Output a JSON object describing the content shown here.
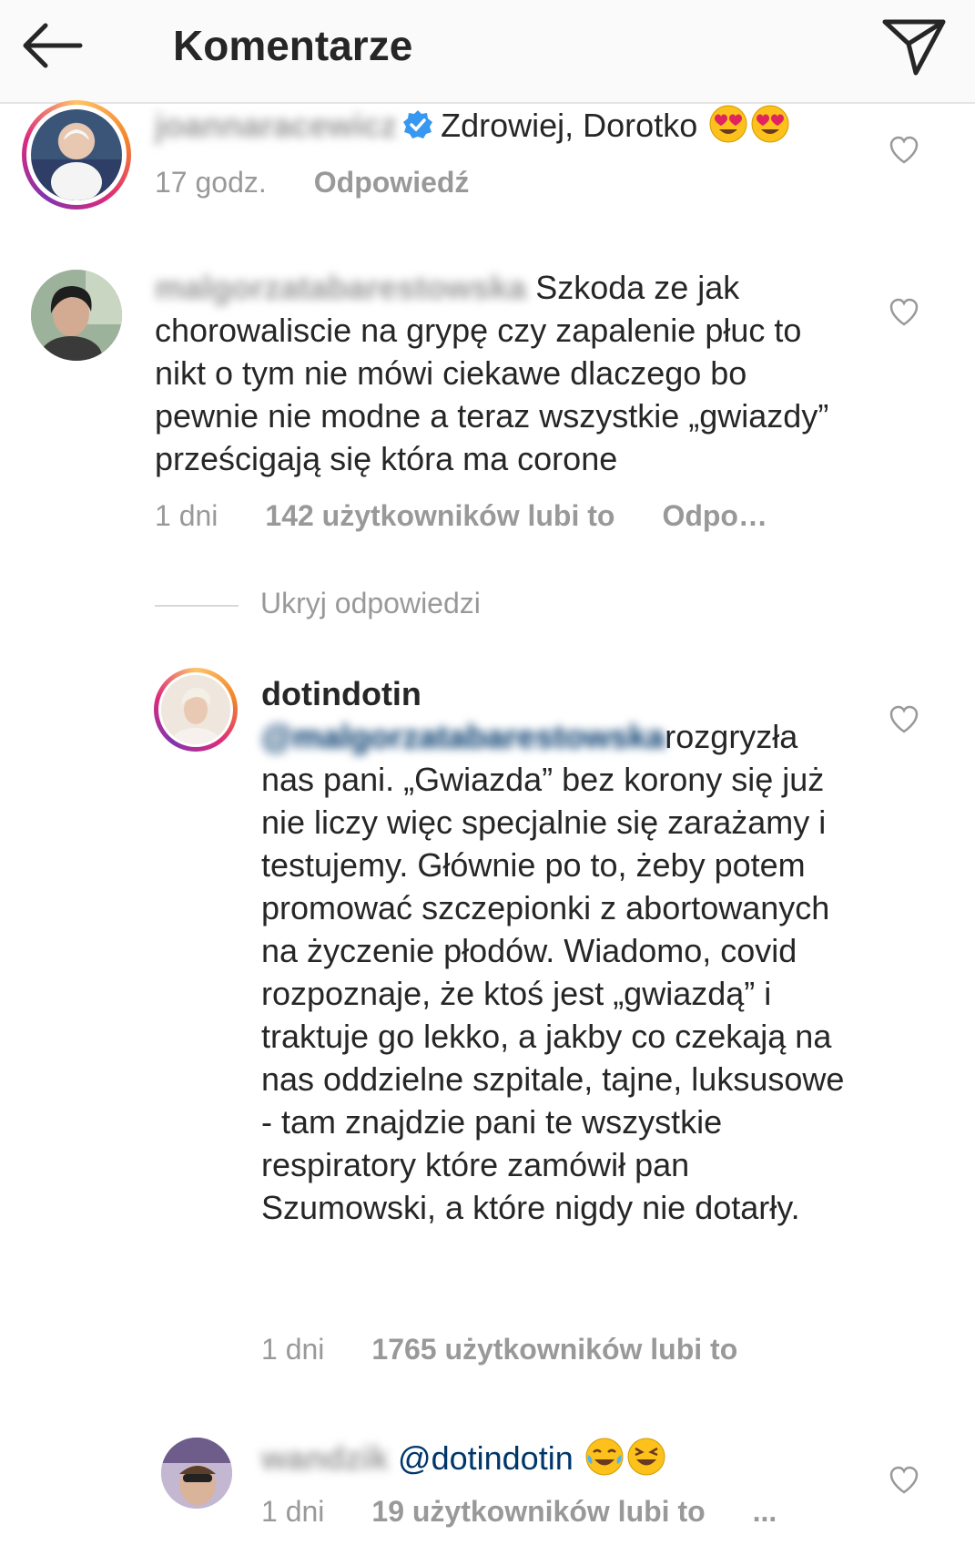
{
  "header": {
    "title": "Komentarze"
  },
  "comments": [
    {
      "username": "joannaracewicz",
      "text": "Zdrowiej, Dorotko",
      "time": "17 godz.",
      "reply": "Odpowiedź"
    },
    {
      "username": "malgorzatabarestowska",
      "text": "Szkoda ze jak chorowaliscie na grypę czy zapalenie płuc to nikt o tym nie mówi ciekawe dlaczego bo pewnie nie modne a teraz wszystkie „gwiazdy” prześcigają się która ma corone",
      "time": "1 dni",
      "likes": "142 użytkowników lubi to",
      "reply": "Odpo…"
    }
  ],
  "hide_replies": "Ukryj odpowiedzi",
  "replies": [
    {
      "username": "dotindotin",
      "mention": "@malgorzatabarestowska",
      "text": "rozgryzła nas pani. „Gwiazda” bez korony się już nie liczy więc specjalnie się zarażamy i testujemy. Głównie po to, żeby potem promować szczepionki z abortowanych na życzenie płodów. Wiadomo, covid rozpoznaje, że ktoś jest „gwiazdą” i traktuje go lekko, a jakby co czekają na nas oddzielne szpitale, tajne, luksusowe - tam znajdzie pani te wszystkie respiratory które zamówił pan Szumowski, a które nigdy nie dotarły.",
      "time": "1 dni",
      "likes": "1765 użytkowników lubi to"
    },
    {
      "username": "wandzik",
      "text": "@dotindotin",
      "time": "1 dni",
      "likes": "19 użytkowników lubi to",
      "more": "..."
    }
  ],
  "colors": {
    "text": "#262626",
    "meta": "#999999",
    "verified": "#3897f0",
    "header_bg": "#fafafa"
  }
}
